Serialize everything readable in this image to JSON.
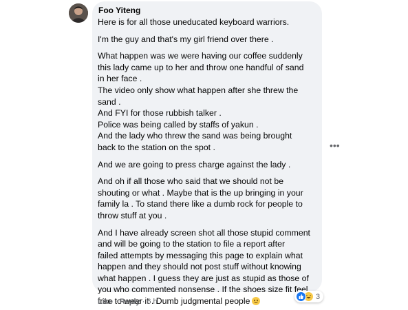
{
  "comment": {
    "author": "Foo Yiteng",
    "paragraphs": [
      [
        "Here is for all those uneducated keyboard warriors."
      ],
      [
        "I'm the guy and that's my girl friend over there ."
      ],
      [
        "What happen was we were having our coffee suddenly",
        "this lady came up to her and throw one handful of sand",
        "in her face .",
        "The video only show what happen after she threw the",
        "sand .",
        "And FYI for those rubbish talker .",
        "Police was being called by staffs of yakun .",
        "And the lady who threw the sand was being brought",
        "back to the station on the spot ."
      ],
      [
        "And we are going to press charge against the lady ."
      ],
      [
        "And oh if all those who said that we should not be",
        "shouting or what . Maybe that is the up bringing in your",
        "family la . To stand there like a dumb rock for people to",
        "throw stuff at you ."
      ],
      [
        "And I have already screen shot all those stupid comment",
        "and will be going to the station to file a report after",
        "failed attempts by messaging this page to explain what",
        "happen and they should not post stuff without knowing",
        "what happen . I guess they are just as stupid as those of",
        "you who commented nonsense . If the shoes size fit feel",
        "free to wear it . Dumb judgmental people"
      ]
    ],
    "trailing_emoji": "smile-emoji",
    "actions": {
      "like": "Like",
      "separator": "·",
      "reply": "Reply",
      "time": "6 h"
    },
    "reactions": {
      "icons": [
        "like-icon",
        "haha-icon"
      ],
      "count": "3"
    },
    "more_icon": "more-options-icon",
    "colors": {
      "bubble": "#f0f2f5",
      "meta": "#65676b",
      "like": "#1877f2",
      "haha": "#f7c948"
    }
  }
}
